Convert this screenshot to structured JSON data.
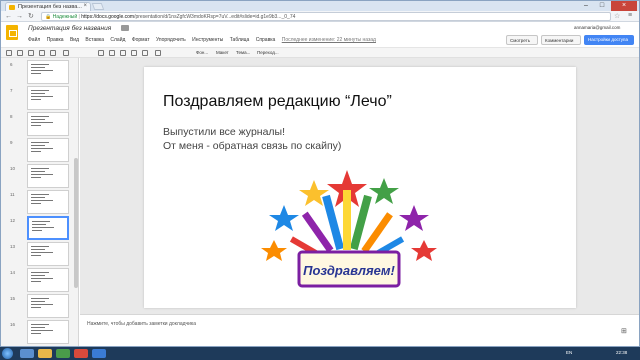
{
  "browser": {
    "tab_title": "Презентация без назва...",
    "address": {
      "secure_label": "Надежный",
      "url_host": "https://docs.google.com",
      "url_rest": "/presentation/d/1nsZgfcW3mdoKRsp=7uV...edit#slide=id.g1e9b3..._0_74"
    }
  },
  "docs": {
    "title": "Презентация без названия",
    "user_email": "annamaria@gmail.com",
    "menu": [
      "Файл",
      "Правка",
      "Вид",
      "Вставка",
      "Слайд",
      "Формат",
      "Упорядочить",
      "Инструменты",
      "Таблица",
      "Справка"
    ],
    "last_edit": "Последнее изменение: 22 минуты назад",
    "present_label": "Смотреть",
    "comments_label": "Комментарии",
    "share_label": "Настройки доступа",
    "toolbar": {
      "background": "Фон...",
      "layout": "Макет",
      "theme": "Тема...",
      "transition": "Переход..."
    }
  },
  "filmstrip": {
    "thumbs": [
      {
        "num": "6"
      },
      {
        "num": "7"
      },
      {
        "num": "8"
      },
      {
        "num": "9"
      },
      {
        "num": "10"
      },
      {
        "num": "11"
      },
      {
        "num": "12"
      },
      {
        "num": "13"
      },
      {
        "num": "14"
      },
      {
        "num": "15"
      },
      {
        "num": "16"
      }
    ],
    "active": "12"
  },
  "slide": {
    "title": "Поздравляем редакцию “Лечо”",
    "body_line1": "Выпустили все журналы!",
    "body_line2": "От меня  - обратная связь по скайпу)",
    "image_text": "Поздравляем!"
  },
  "notes": {
    "placeholder": "Нажмите, чтобы добавить заметки докладчика"
  },
  "taskbar": {
    "lang": "EN",
    "time": "22:38"
  },
  "colors": {
    "accent": "#4285f4",
    "slides_brand": "#f4b400",
    "taskbar": "#1e3a5a"
  }
}
